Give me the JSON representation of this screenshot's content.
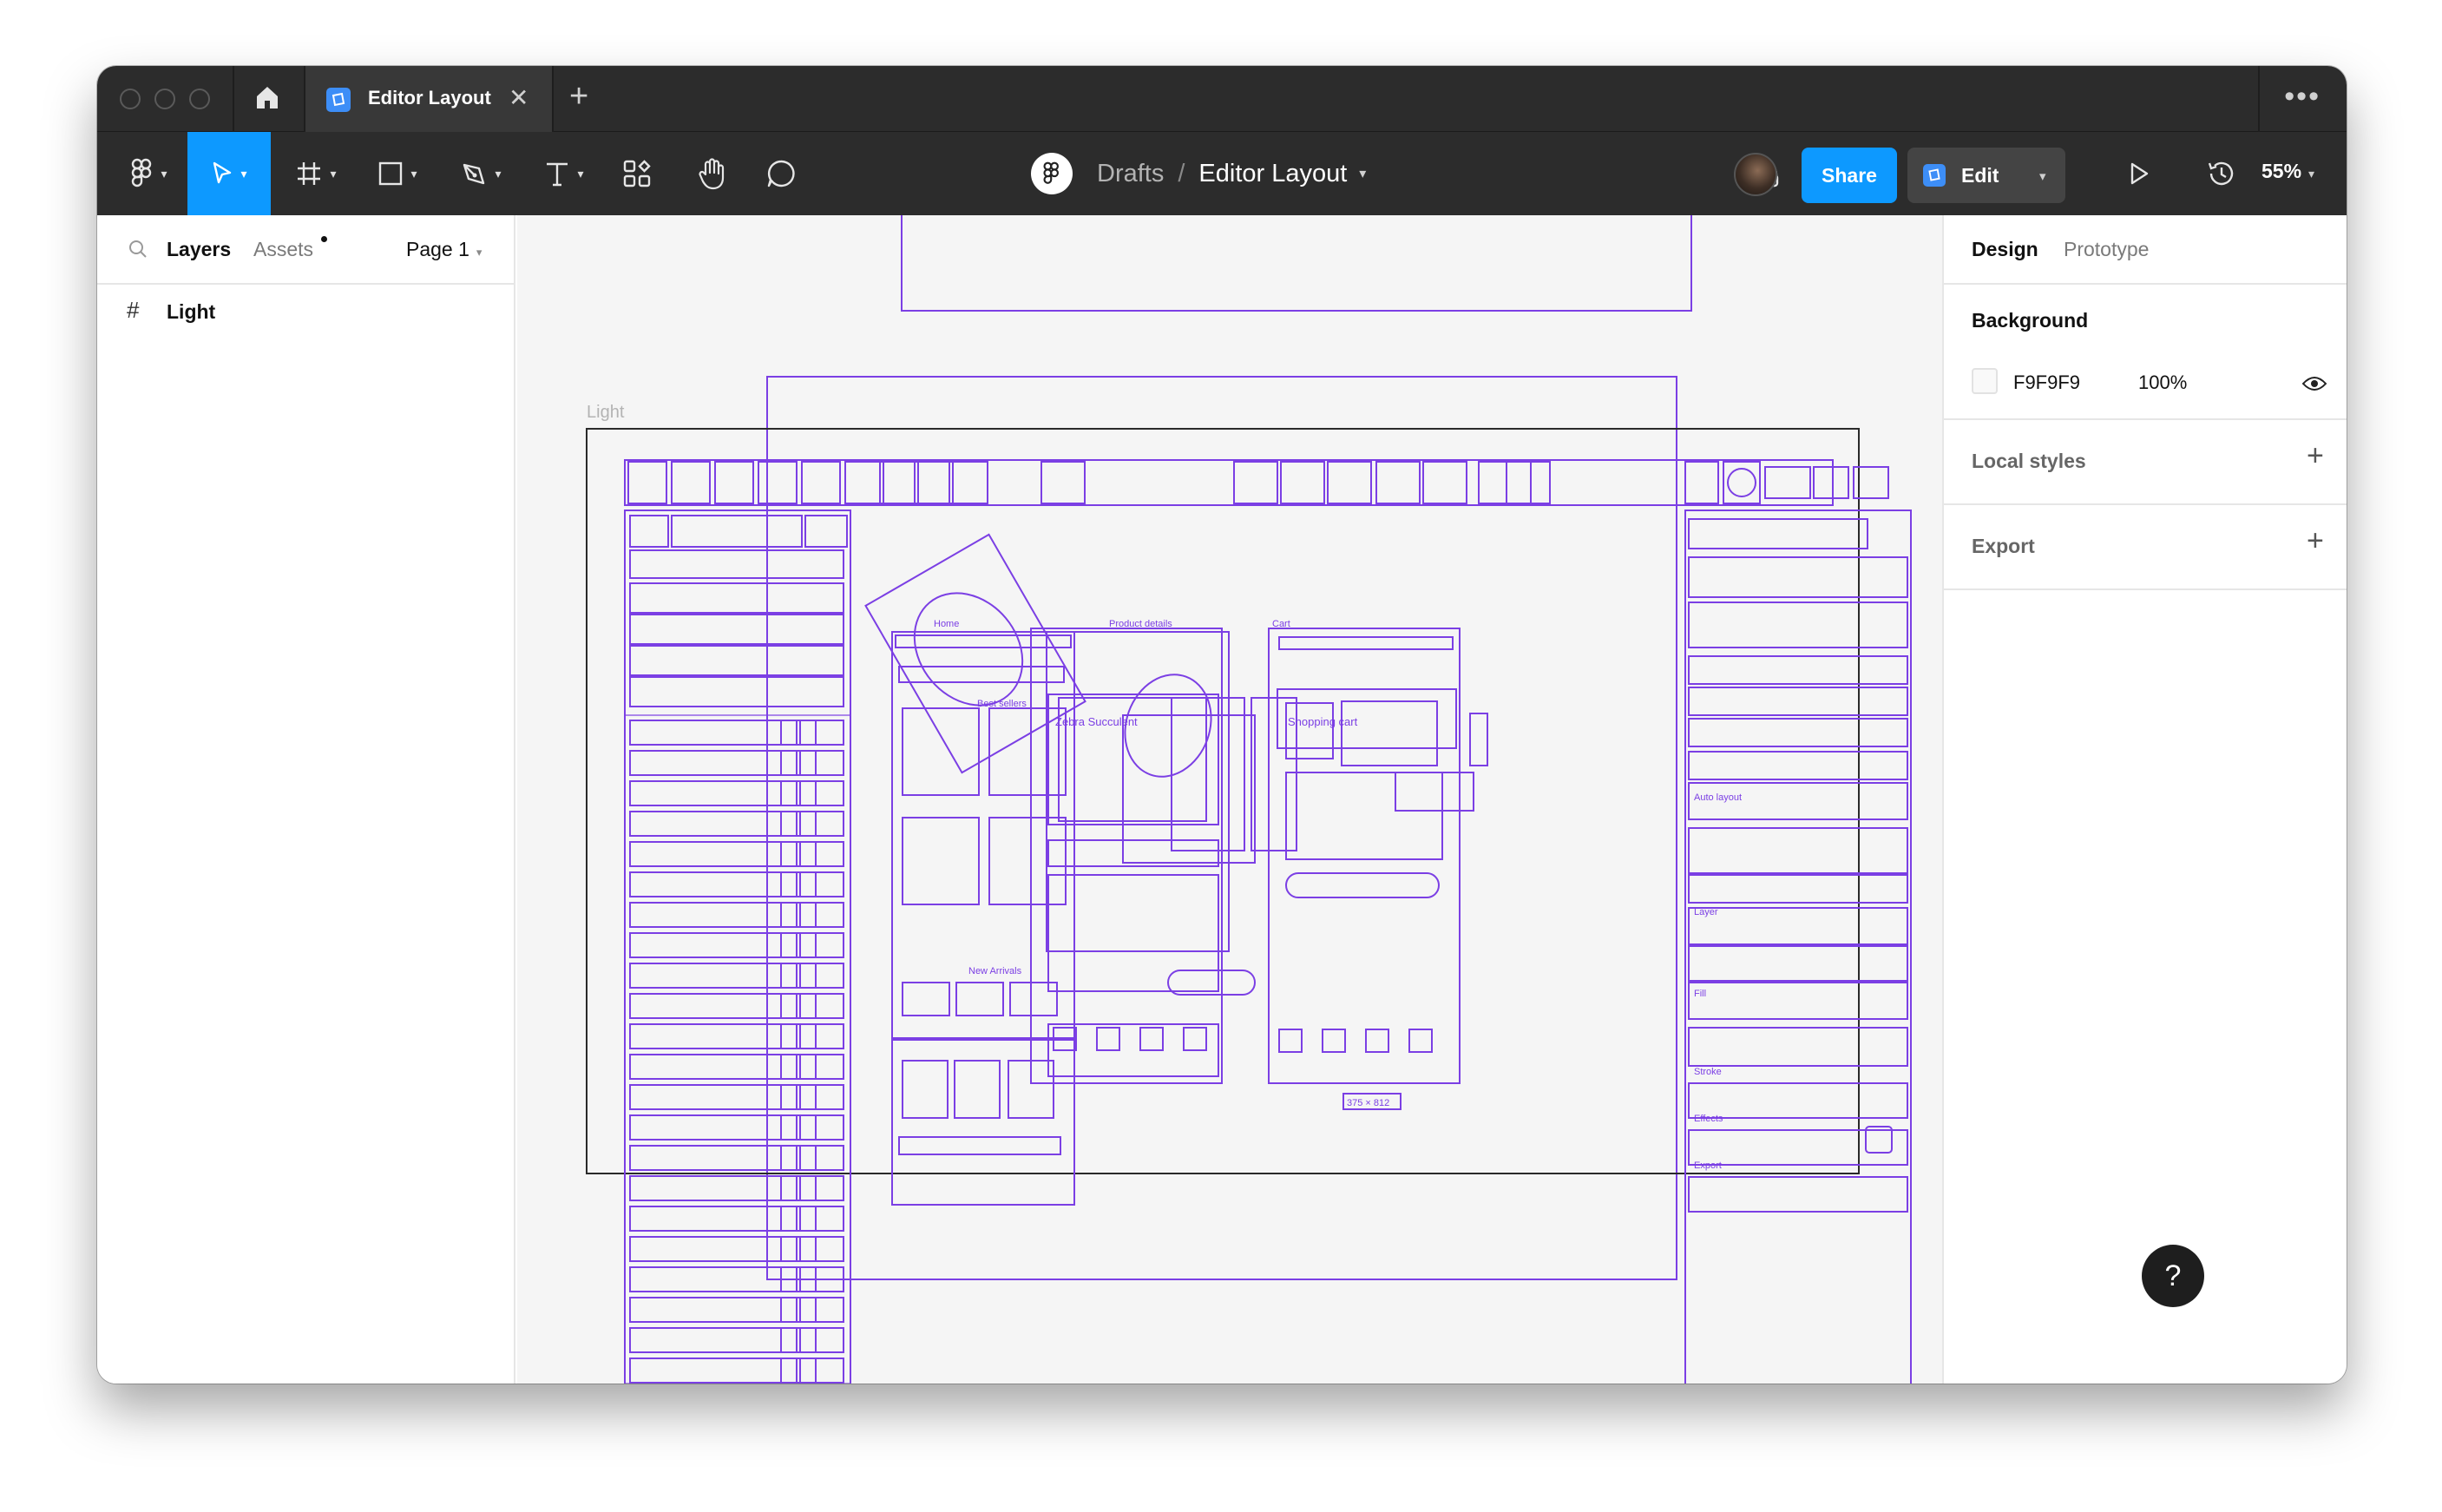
{
  "window": {
    "tab_title": "Editor Layout",
    "tab_close": "✕",
    "tab_add": "+",
    "more": "•••"
  },
  "toolbar": {
    "breadcrumb": {
      "project": "Drafts",
      "separator": "/",
      "file": "Editor Layout"
    },
    "share_label": "Share",
    "edit_label": "Edit",
    "zoom": "55%",
    "tools": [
      "main-menu",
      "move",
      "frame",
      "shape",
      "pen",
      "text",
      "resources",
      "hand",
      "comment"
    ],
    "icons": [
      "home-icon",
      "figma-logo-icon",
      "headphones-icon",
      "play-icon",
      "history-icon"
    ]
  },
  "left_panel": {
    "tabs": {
      "layers": "Layers",
      "assets": "Assets"
    },
    "page_selector": "Page 1",
    "layers": [
      {
        "name": "Light",
        "type": "frame"
      }
    ]
  },
  "canvas": {
    "frame_label": "Light",
    "background": "#F5F5F5",
    "wireframe_color": "#7B3FE4"
  },
  "right_panel": {
    "tabs": {
      "design": "Design",
      "prototype": "Prototype"
    },
    "background": {
      "title": "Background",
      "hex": "F9F9F9",
      "opacity": "100%"
    },
    "local_styles": "Local styles",
    "export": "Export"
  },
  "help": "?",
  "colors": {
    "accent": "#0D99FF",
    "dark_ui": "#2C2C2C",
    "wireframe": "#7B3FE4"
  }
}
